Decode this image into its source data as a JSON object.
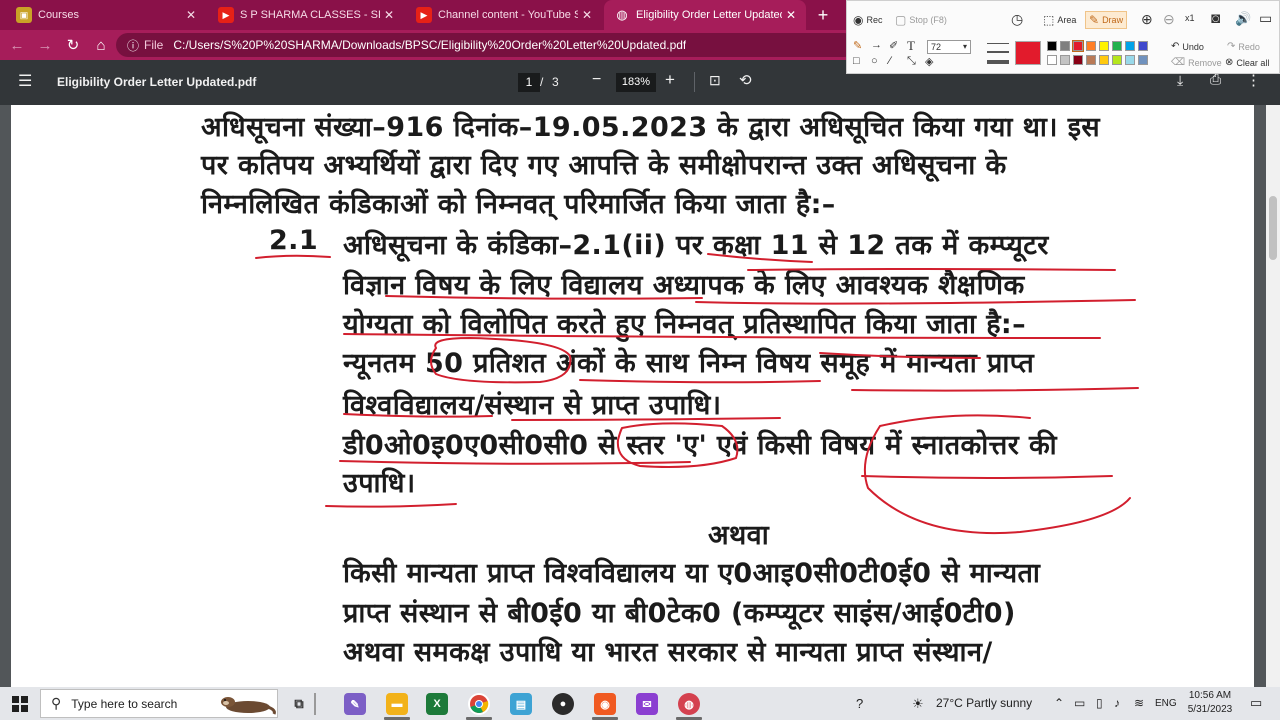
{
  "browser": {
    "tabs": [
      {
        "title": "Courses",
        "icon": "courses-icon",
        "active": false
      },
      {
        "title": "S P SHARMA CLASSES - SPSC - Y",
        "icon": "youtube-icon",
        "active": false
      },
      {
        "title": "Channel content - YouTube Studi",
        "icon": "youtube-icon",
        "active": false
      },
      {
        "title": "Eligibility Order Letter Updated.p",
        "icon": "globe-icon",
        "active": true
      }
    ],
    "new_tab": "+",
    "close_glyph": "✕",
    "address": {
      "scheme": "File",
      "url": "C:/Users/S%20P%20SHARMA/Downloads/BPSC/Eligibility%20Order%20Letter%20Updated.pdf"
    }
  },
  "pdf_toolbar": {
    "title": "Eligibility Order Letter Updated.pdf",
    "page_current": "1",
    "page_separator": "/",
    "page_total": "3",
    "zoom": "183%"
  },
  "document": {
    "lines": [
      "अधिसूचना संख्या–916 दिनांक–19.05.2023 के द्वारा अधिसूचित किया गया था। इस",
      "पर कतिपय अभ्यर्थियों द्वारा दिए गए आपत्ति के समीक्षोपरान्त उक्त अधिसूचना के",
      "निम्नलिखित कंडिकाओं को निम्नवत् परिमार्जित किया जाता है:–",
      "2.1",
      "अधिसूचना के कंडिका–2.1(ii) पर कक्षा 11 से 12 तक में कम्प्यूटर",
      "विज्ञान विषय के लिए विद्यालय अध्यापक के लिए आवश्यक शैक्षणिक",
      "योग्यता को विलोपित करते हुए निम्नवत् प्रतिस्थापित किया जाता है:–",
      "न्यूनतम 50 प्रतिशत अंकों के साथ निम्न विषय समूह में मान्यता प्राप्त",
      "विश्वविद्यालय/संस्थान से प्राप्त उपाधि।",
      "डी0ओ0इ0ए0सी0सी0 से स्तर 'ए' एवं किसी विषय में स्नातकोत्तर की",
      "उपाधि।",
      "अथवा",
      "किसी मान्यता प्राप्त विश्वविद्यालय या ए0आइ0सी0टी0ई0 से मान्यता",
      "प्राप्त संस्थान से बी0ई0 या बी0टेक0 (कम्प्यूटर साइंस/आई0टी0)",
      "अथवा समकक्ष उपाधि या भारत सरकार से मान्यता प्राप्त संस्थान/"
    ],
    "annotation_color": "#d21f2e"
  },
  "annotation_tool": {
    "rec": "Rec",
    "stop": "Stop (F8)",
    "area": "Area",
    "draw": "Draw",
    "zoom_level": "x1",
    "font_size": "72",
    "undo": "Undo",
    "redo": "Redo",
    "remove": "Remove",
    "clear_all": "Clear all",
    "selected_color": "#e21b2c",
    "palette": [
      "#000000",
      "#7f7f7f",
      "#e21b2c",
      "#ff7f27",
      "#fff200",
      "#22b14c",
      "#00a2e8",
      "#3f48cc",
      "#ffffff",
      "#c3c3c3",
      "#880015",
      "#b97a57",
      "#ffc90e",
      "#b5e61d",
      "#99d9ea",
      "#7092be"
    ]
  },
  "taskbar": {
    "search_placeholder": "Type here to search",
    "weather": "27°C  Partly sunny",
    "language": "ENG",
    "time": "10:56 AM",
    "date": "5/31/2023"
  }
}
